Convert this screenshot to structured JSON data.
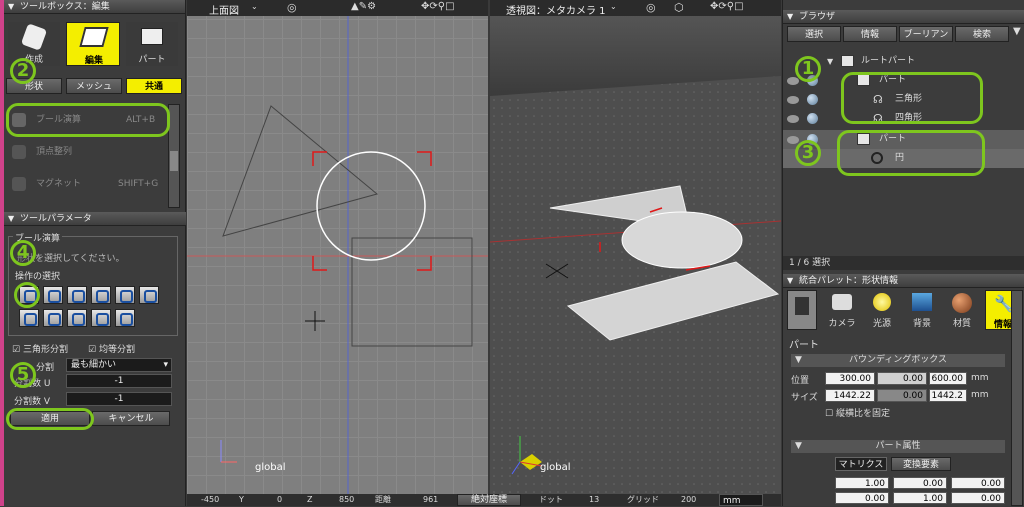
{
  "toolbox": {
    "title": "ツールボックス：編集",
    "modes": [
      {
        "label": "作成",
        "icon": "create-icon"
      },
      {
        "label": "編集",
        "icon": "edit-icon"
      },
      {
        "label": "パート",
        "icon": "part-icon"
      }
    ],
    "subtabs": [
      "形状",
      "メッシュ",
      "共通"
    ],
    "items": [
      {
        "label": "ブール演算",
        "shortcut": "ALT+B"
      },
      {
        "label": "頂点整列",
        "shortcut": ""
      },
      {
        "label": "マグネット",
        "shortcut": "SHIFT+G"
      }
    ]
  },
  "tool_params": {
    "title": "ツールパラメータ",
    "section": "ブール演算",
    "hint": "形状を選択してください。",
    "op_title": "操作の選択",
    "triangle_split": "三角形分割",
    "equal_split": "均等分割",
    "split_label": "分割",
    "split_value": "最も細かい",
    "split_u_label": "分割数 U",
    "split_u_value": "-1",
    "split_v_label": "分割数 V",
    "split_v_value": "-1",
    "apply": "適用",
    "cancel": "キャンセル"
  },
  "viewports": {
    "top": {
      "title": "上面図",
      "axis_label": "global"
    },
    "persp": {
      "title": "透視図：メタカメラ 1",
      "axis_label": "global"
    }
  },
  "statusbar": {
    "items": [
      "-450",
      "Y",
      "0",
      "Z",
      "850",
      "距離",
      "961",
      "絶対座標",
      "ドット",
      "13",
      "グリッド",
      "200",
      "mm"
    ]
  },
  "browser": {
    "title": "ブラウザ",
    "tabs": [
      "選択",
      "情報",
      "ブーリアン",
      "検索"
    ],
    "tree": [
      {
        "label": "ルートパート",
        "indent": 0
      },
      {
        "label": "パート",
        "indent": 1
      },
      {
        "label": "三角形",
        "indent": 2
      },
      {
        "label": "四角形",
        "indent": 2
      },
      {
        "label": "パート",
        "indent": 1
      },
      {
        "label": "円",
        "indent": 2
      }
    ],
    "status": "1 / 6 選択"
  },
  "integrated": {
    "title": "統合パレット：形状情報",
    "tabs": [
      "カメラ",
      "光源",
      "背景",
      "材質",
      "情報"
    ],
    "part_label": "パート",
    "bbox_title": "バウンディングボックス",
    "pos_label": "位置",
    "pos": [
      "300.00",
      "0.00",
      "600.00"
    ],
    "size_label": "サイズ",
    "size": [
      "1442.22",
      "0.00",
      "1442.2"
    ],
    "unit": "mm",
    "keep_ratio": "縦横比を固定",
    "attr_title": "パート属性",
    "matrix_tabs": [
      "マトリクス",
      "変換要素"
    ],
    "matrix": [
      [
        "1.00",
        "0.00",
        "0.00"
      ],
      [
        "0.00",
        "1.00",
        "0.00"
      ]
    ]
  },
  "annotations": [
    "1",
    "2",
    "3",
    "4",
    "5"
  ]
}
